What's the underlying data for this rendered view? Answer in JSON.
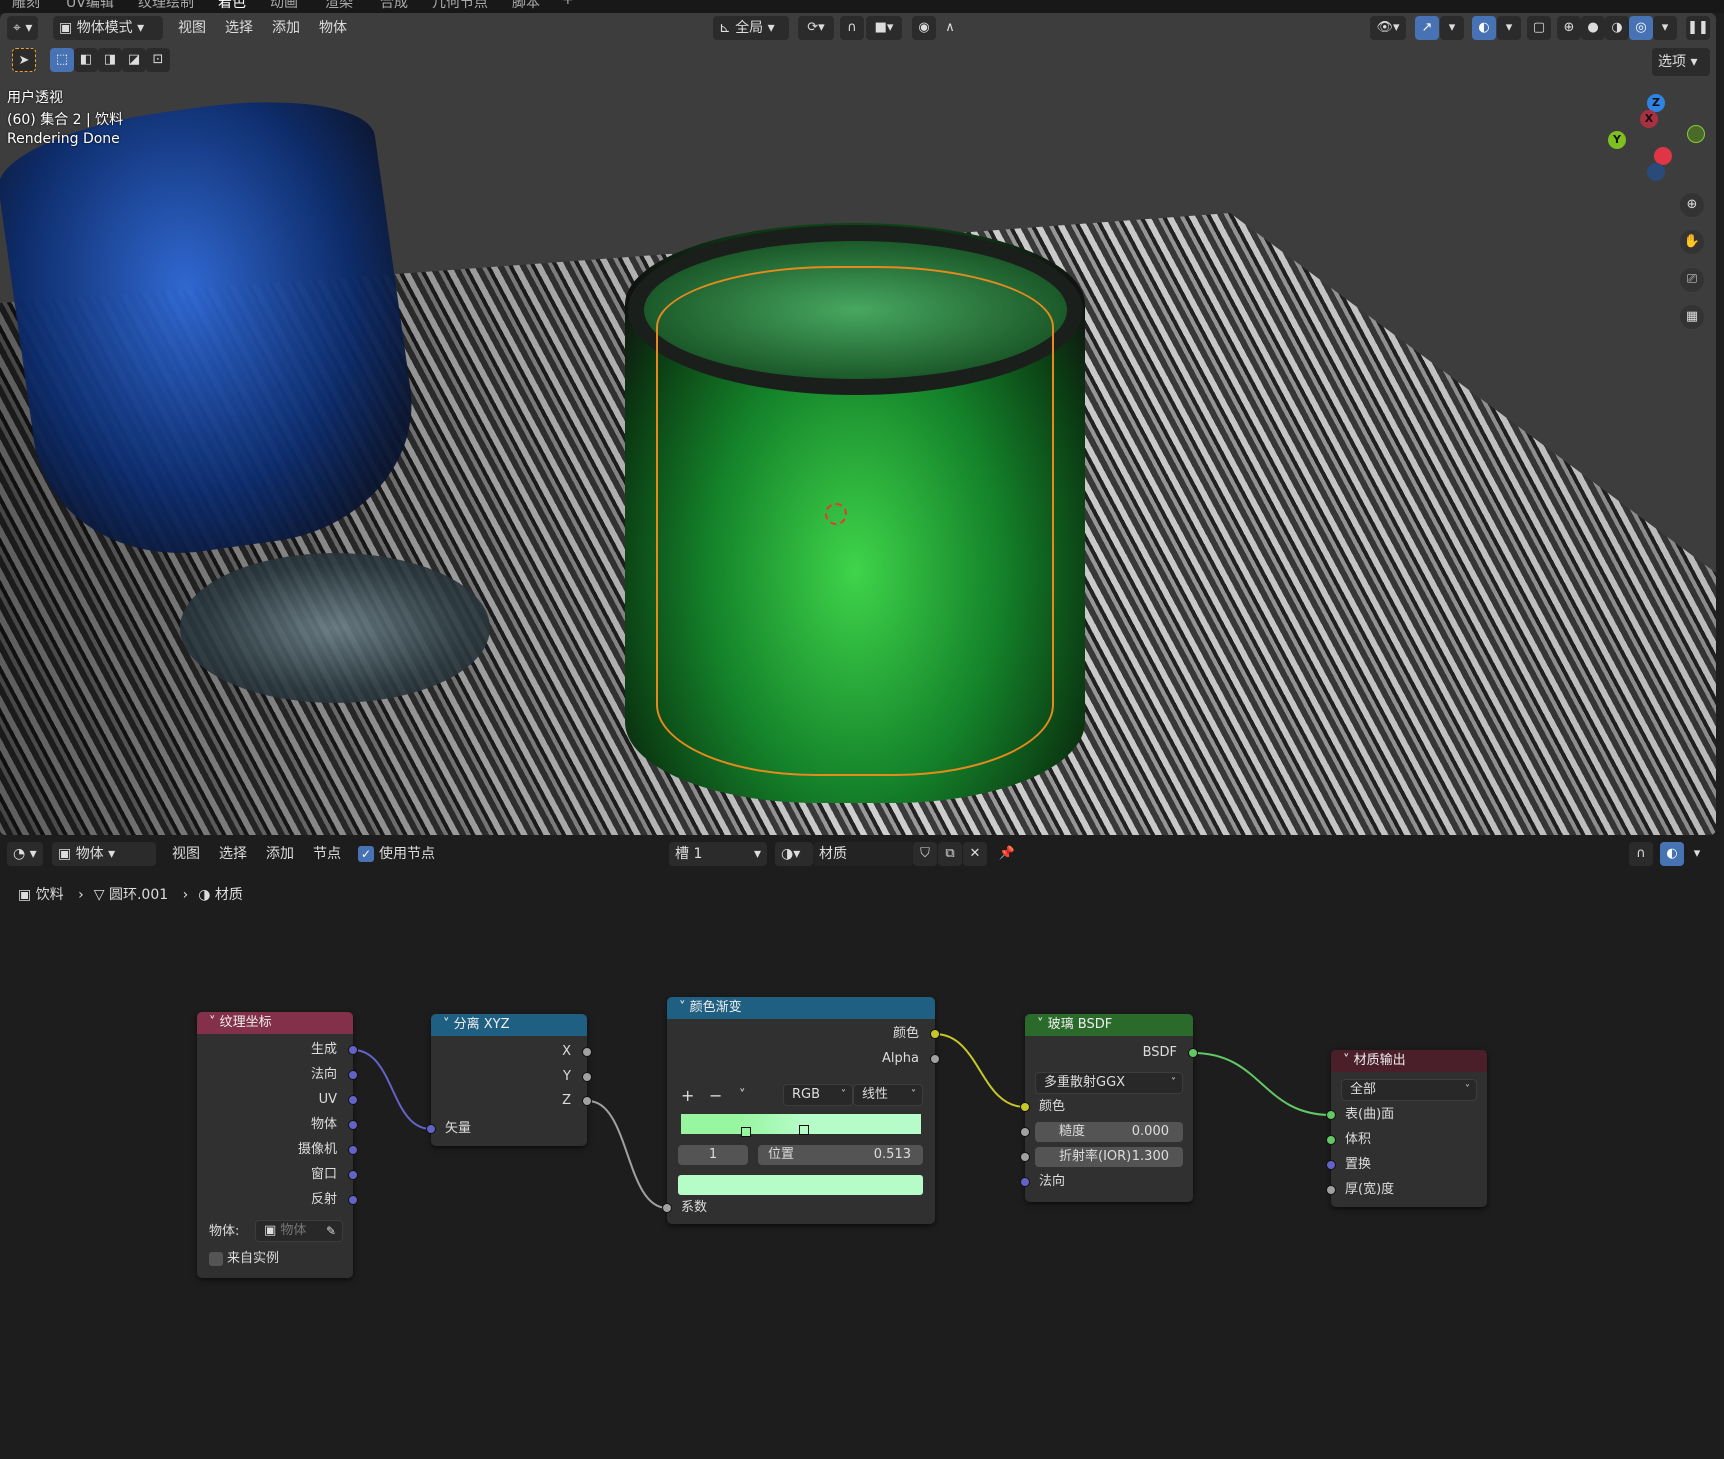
{
  "workspace_tabs": [
    "雕刻",
    "UV编辑",
    "纹理绘制",
    "着色",
    "动画",
    "渲染",
    "合成",
    "几何节点",
    "脚本",
    "+"
  ],
  "viewport": {
    "mode": "物体模式",
    "menus": [
      "视图",
      "选择",
      "添加",
      "物体"
    ],
    "transform_orientation": "全局",
    "options": "选项",
    "overlay_lines": [
      "用户透视",
      "(60) 集合 2 | 饮料",
      "Rendering Done"
    ],
    "gizmo_axes": [
      "X",
      "Y",
      "Z"
    ]
  },
  "node_editor": {
    "object_mode": "物体",
    "menus": [
      "视图",
      "选择",
      "添加",
      "节点"
    ],
    "use_nodes_label": "使用节点",
    "use_nodes": true,
    "slot": "槽 1",
    "material": "材质",
    "breadcrumb": [
      "饮料",
      "圆环.001",
      "材质"
    ]
  },
  "nodes": {
    "tex_coord": {
      "title": "纹理坐标",
      "outputs": [
        "生成",
        "法向",
        "UV",
        "物体",
        "摄像机",
        "窗口",
        "反射"
      ],
      "object_label": "物体:",
      "object_placeholder": "物体",
      "from_instancer": "来自实例"
    },
    "separate_xyz": {
      "title": "分离 XYZ",
      "outputs": [
        "X",
        "Y",
        "Z"
      ],
      "input": "矢量"
    },
    "color_ramp": {
      "title": "颜色渐变",
      "outputs": [
        "颜色",
        "Alpha"
      ],
      "color_mode": "RGB",
      "interpolation": "线性",
      "stop_index": "1",
      "pos_label": "位置",
      "pos_value": "0.513",
      "input": "系数",
      "ramp_color": "#98f5a0",
      "stop_color": "#b6fcc8"
    },
    "glass_bsdf": {
      "title": "玻璃 BSDF",
      "output": "BSDF",
      "distribution": "多重散射GGX",
      "color_label": "颜色",
      "roughness_label": "糙度",
      "roughness": "0.000",
      "ior_label": "折射率(IOR)",
      "ior": "1.300",
      "normal_label": "法向"
    },
    "material_output": {
      "title": "材质输出",
      "target": "全部",
      "inputs": [
        "表(曲)面",
        "体积",
        "置换",
        "厚(宽)度"
      ]
    }
  },
  "colors": {
    "accent": "#4772b3",
    "tex_header": "#83314a",
    "vector_header": "#1e5f82",
    "shader_header": "#2a6a2a",
    "output_header": "#4a1f2a",
    "socket_vector": "#6363c7",
    "socket_color": "#c7c729",
    "socket_float": "#a1a1a1",
    "socket_shader": "#63c763"
  }
}
